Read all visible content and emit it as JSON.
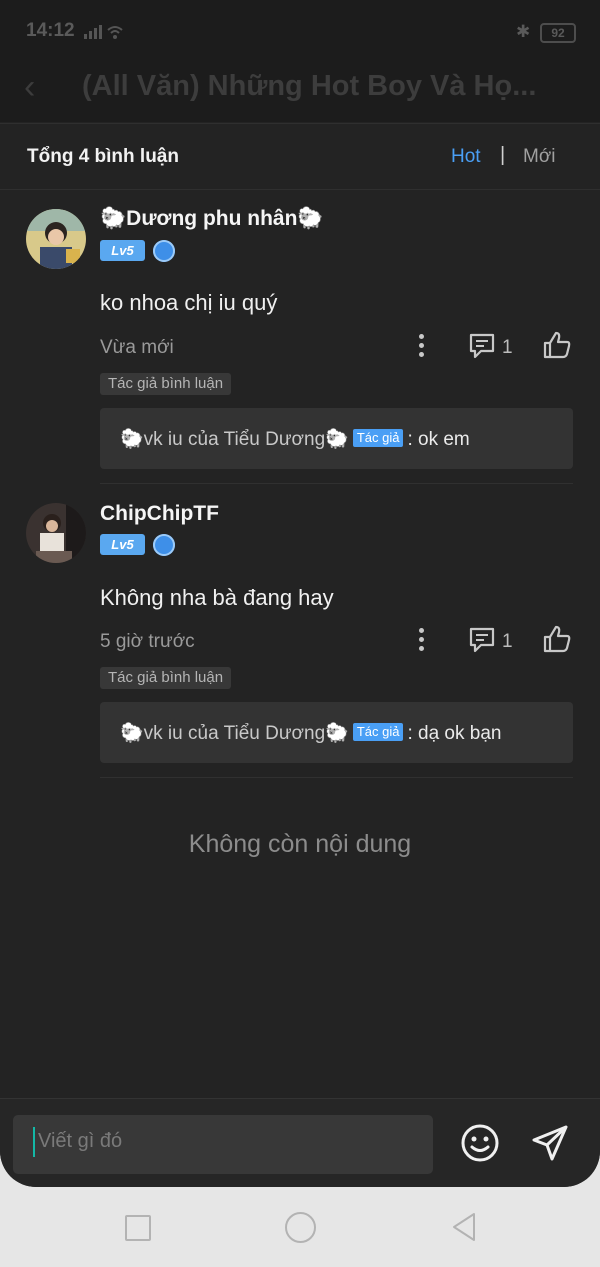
{
  "status": {
    "time": "14:12",
    "battery": "92"
  },
  "topbar": {
    "title": "(All Văn) Những Hot Boy Và Họ..."
  },
  "header": {
    "total": "Tổng 4 bình luận",
    "sort_hot": "Hot",
    "sort_sep": "|",
    "sort_new": "Mới"
  },
  "comments": [
    {
      "user": "🐑Dương phu nhân🐑",
      "level": "Lv5",
      "text": "ko nhoa chị iu quý",
      "time": "Vừa mới",
      "reply_count": "1",
      "tag": "Tác giả bình luận",
      "reply": {
        "user": "🐑vk iu của Tiểu Dương🐑",
        "badge": "Tác giả",
        "text": ": ok em"
      }
    },
    {
      "user": "ChipChipTF",
      "level": "Lv5",
      "text": "Không nha bà đang hay",
      "time": "5 giờ trước",
      "reply_count": "1",
      "tag": "Tác giả bình luận",
      "reply": {
        "user": "🐑vk iu của Tiểu Dương🐑",
        "badge": "Tác giả",
        "text": ": dạ ok bạn"
      }
    }
  ],
  "no_more": "Không còn nội dung",
  "input": {
    "placeholder": "Viết gì đó"
  },
  "icons": [
    "back-icon",
    "more-icon",
    "reply-icon",
    "like-icon",
    "emoji-icon",
    "send-icon",
    "vip-badge-icon"
  ],
  "colors": {
    "accent": "#4a9ff5",
    "background": "#232323",
    "level_badge": "#5aa8f0"
  }
}
